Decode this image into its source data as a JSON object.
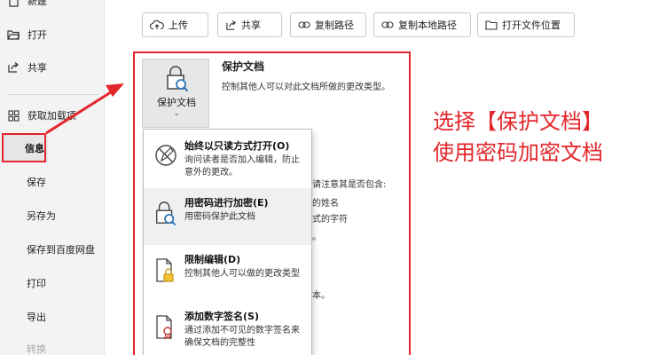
{
  "sidebar": {
    "items": [
      {
        "label": "新建",
        "icon": "new-doc-icon"
      },
      {
        "label": "打开",
        "icon": "folder-open-icon"
      },
      {
        "label": "共享",
        "icon": "share-icon"
      },
      {
        "label": "获取加载项",
        "icon": "add-ins-icon"
      },
      {
        "label": "信息"
      },
      {
        "label": "保存"
      },
      {
        "label": "另存为"
      },
      {
        "label": "保存到百度网盘"
      },
      {
        "label": "打印"
      },
      {
        "label": "导出"
      },
      {
        "label": "转换"
      }
    ]
  },
  "toolbar": {
    "upload": "上传",
    "share": "共享",
    "copy_path": "复制路径",
    "copy_local_path": "复制本地路径",
    "open_location": "打开文件位置"
  },
  "protect": {
    "button_label": "保护文档",
    "caret": "⌄",
    "title": "保护文档",
    "desc": "控制其他人可以对此文档所做的更改类型。"
  },
  "background_text": [
    "请注意其是否包含:",
    "的姓名",
    "式的字符",
    "。",
    "本。"
  ],
  "dropdown": {
    "items": [
      {
        "title": "始终以只读方式打开(O)",
        "desc": "询问读者是否加入编辑，防止意外的更改。"
      },
      {
        "title": "用密码进行加密(E)",
        "desc": "用密码保护此文档"
      },
      {
        "title": "限制编辑(D)",
        "desc": "控制其他人可以做的更改类型"
      },
      {
        "title": "添加数字签名(S)",
        "desc": "通过添加不可见的数字签名来确保文档的完整性"
      }
    ]
  },
  "callout": {
    "line1": "选择【保护文档】",
    "line2": "使用密码加密文档"
  },
  "colors": {
    "highlight_red": "#e3262b",
    "sidebar_bg": "#f3f3f3"
  }
}
